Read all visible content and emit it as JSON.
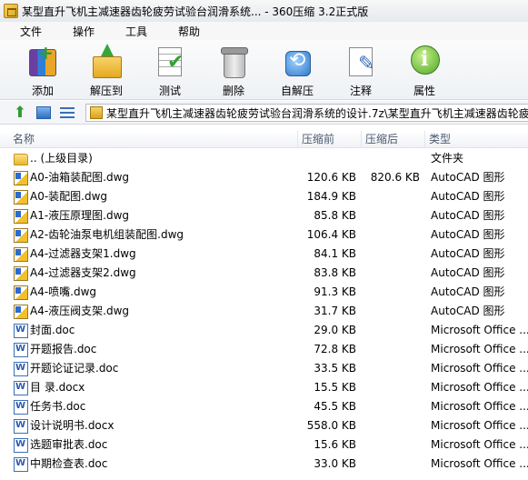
{
  "window": {
    "title": "某型直升飞机主减速器齿轮疲劳试验台润滑系统... - 360压缩 3.2正式版"
  },
  "menu": [
    "文件",
    "操作",
    "工具",
    "帮助"
  ],
  "toolbar": [
    {
      "label": "添加",
      "icon": "add-archive-icon"
    },
    {
      "label": "解压到",
      "icon": "extract-icon"
    },
    {
      "label": "测试",
      "icon": "test-icon"
    },
    {
      "label": "删除",
      "icon": "delete-icon"
    },
    {
      "label": "自解压",
      "icon": "self-extract-icon"
    },
    {
      "label": "注释",
      "icon": "comment-icon"
    },
    {
      "label": "属性",
      "icon": "info-icon"
    }
  ],
  "address": {
    "path": "某型直升飞机主减速器齿轮疲劳试验台润滑系统的设计.7z\\某型直升飞机主减速器齿轮疲"
  },
  "columns": {
    "name": "名称",
    "size": "压缩前",
    "packed": "压缩后",
    "type": "类型"
  },
  "files": [
    {
      "name": ".. (上级目录)",
      "size": "",
      "packed": "",
      "type": "文件夹",
      "icon": "folder-icon"
    },
    {
      "name": "A0-油箱装配图.dwg",
      "size": "120.6 KB",
      "packed": "820.6 KB",
      "type": "AutoCAD 图形",
      "icon": "dwg-icon"
    },
    {
      "name": "A0-装配图.dwg",
      "size": "184.9 KB",
      "packed": "",
      "type": "AutoCAD 图形",
      "icon": "dwg-icon"
    },
    {
      "name": "A1-液压原理图.dwg",
      "size": "85.8 KB",
      "packed": "",
      "type": "AutoCAD 图形",
      "icon": "dwg-icon"
    },
    {
      "name": "A2-齿轮油泵电机组装配图.dwg",
      "size": "106.4 KB",
      "packed": "",
      "type": "AutoCAD 图形",
      "icon": "dwg-icon"
    },
    {
      "name": "A4-过滤器支架1.dwg",
      "size": "84.1 KB",
      "packed": "",
      "type": "AutoCAD 图形",
      "icon": "dwg-icon"
    },
    {
      "name": "A4-过滤器支架2.dwg",
      "size": "83.8 KB",
      "packed": "",
      "type": "AutoCAD 图形",
      "icon": "dwg-icon"
    },
    {
      "name": "A4-喷嘴.dwg",
      "size": "91.3 KB",
      "packed": "",
      "type": "AutoCAD 图形",
      "icon": "dwg-icon"
    },
    {
      "name": "A4-液压阀支架.dwg",
      "size": "31.7 KB",
      "packed": "",
      "type": "AutoCAD 图形",
      "icon": "dwg-icon"
    },
    {
      "name": "封面.doc",
      "size": "29.0 KB",
      "packed": "",
      "type": "Microsoft Office ...",
      "icon": "word-doc-icon"
    },
    {
      "name": "开题报告.doc",
      "size": "72.8 KB",
      "packed": "",
      "type": "Microsoft Office ...",
      "icon": "word-doc-icon"
    },
    {
      "name": "开题论证记录.doc",
      "size": "33.5 KB",
      "packed": "",
      "type": "Microsoft Office ...",
      "icon": "word-doc-icon"
    },
    {
      "name": "目 录.docx",
      "size": "15.5 KB",
      "packed": "",
      "type": "Microsoft Office ...",
      "icon": "word-doc-icon"
    },
    {
      "name": "任务书.doc",
      "size": "45.5 KB",
      "packed": "",
      "type": "Microsoft Office ...",
      "icon": "word-doc-icon"
    },
    {
      "name": "设计说明书.docx",
      "size": "558.0 KB",
      "packed": "",
      "type": "Microsoft Office ...",
      "icon": "word-doc-icon"
    },
    {
      "name": "选题审批表.doc",
      "size": "15.6 KB",
      "packed": "",
      "type": "Microsoft Office ...",
      "icon": "word-doc-icon"
    },
    {
      "name": "中期检查表.doc",
      "size": "33.0 KB",
      "packed": "",
      "type": "Microsoft Office ...",
      "icon": "word-doc-icon"
    }
  ]
}
